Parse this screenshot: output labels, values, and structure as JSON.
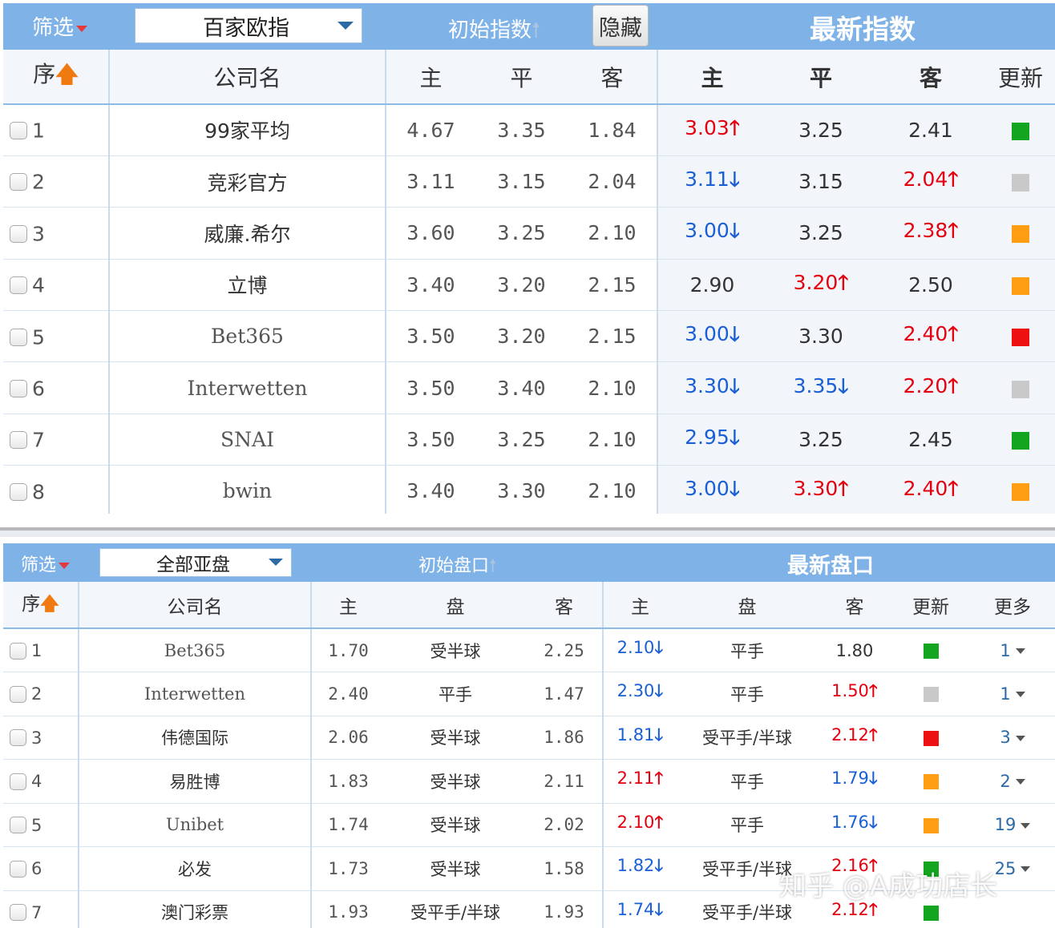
{
  "colors": {
    "header_bg": "#7fb3e8",
    "up": "#e4000f",
    "down": "#1a5fd6",
    "green": "#13a51f",
    "gray": "#c9c9c9",
    "orange": "#ff9d13",
    "red": "#ee1111"
  },
  "euro": {
    "filter_label": "筛选",
    "select_value": "百家欧指",
    "initial_label": "初始指数",
    "hide_button": "隐藏",
    "latest_label": "最新指数",
    "headers": {
      "seq": "序",
      "company": "公司名",
      "home": "主",
      "draw": "平",
      "away": "客",
      "home2": "主",
      "draw2": "平",
      "away2": "客",
      "update": "更新"
    },
    "rows": [
      {
        "idx": "1",
        "company": "99家平均",
        "font": "cjk",
        "ih": "4.67",
        "id": "3.35",
        "ia": "1.84",
        "lh": "3.03",
        "lh_dir": "up",
        "ld": "3.25",
        "ld_dir": "flat",
        "la": "2.41",
        "la_dir": "flat",
        "update_color": "green"
      },
      {
        "idx": "2",
        "company": "竞彩官方",
        "font": "cjk",
        "ih": "3.11",
        "id": "3.15",
        "ia": "2.04",
        "lh": "3.11",
        "lh_dir": "down",
        "ld": "3.15",
        "ld_dir": "flat",
        "la": "2.04",
        "la_dir": "up",
        "update_color": "gray"
      },
      {
        "idx": "3",
        "company": "威廉.希尔",
        "font": "cjk",
        "ih": "3.60",
        "id": "3.25",
        "ia": "2.10",
        "lh": "3.00",
        "lh_dir": "down",
        "ld": "3.25",
        "ld_dir": "flat",
        "la": "2.38",
        "la_dir": "up",
        "update_color": "orange"
      },
      {
        "idx": "4",
        "company": "立博",
        "font": "cjk",
        "ih": "3.40",
        "id": "3.20",
        "ia": "2.15",
        "lh": "2.90",
        "lh_dir": "flat",
        "ld": "3.20",
        "ld_dir": "up",
        "la": "2.50",
        "la_dir": "flat",
        "update_color": "orange"
      },
      {
        "idx": "5",
        "company": "Bet365",
        "font": "serif",
        "ih": "3.50",
        "id": "3.20",
        "ia": "2.15",
        "lh": "3.00",
        "lh_dir": "down",
        "ld": "3.30",
        "ld_dir": "flat",
        "la": "2.40",
        "la_dir": "up",
        "update_color": "red"
      },
      {
        "idx": "6",
        "company": "Interwetten",
        "font": "serif",
        "ih": "3.50",
        "id": "3.40",
        "ia": "2.10",
        "lh": "3.30",
        "lh_dir": "down",
        "ld": "3.35",
        "ld_dir": "down",
        "la": "2.20",
        "la_dir": "up",
        "update_color": "gray"
      },
      {
        "idx": "7",
        "company": "SNAI",
        "font": "serif",
        "ih": "3.50",
        "id": "3.25",
        "ia": "2.10",
        "lh": "2.95",
        "lh_dir": "down",
        "ld": "3.25",
        "ld_dir": "flat",
        "la": "2.45",
        "la_dir": "flat",
        "update_color": "green"
      },
      {
        "idx": "8",
        "company": "bwin",
        "font": "serif",
        "ih": "3.40",
        "id": "3.30",
        "ia": "2.10",
        "lh": "3.00",
        "lh_dir": "down",
        "ld": "3.30",
        "ld_dir": "up",
        "la": "2.40",
        "la_dir": "up",
        "update_color": "orange"
      }
    ]
  },
  "asian": {
    "filter_label": "筛选",
    "select_value": "全部亚盘",
    "initial_label": "初始盘口",
    "latest_label": "最新盘口",
    "headers": {
      "seq": "序",
      "company": "公司名",
      "home": "主",
      "handicap": "盘",
      "away": "客",
      "home2": "主",
      "handicap2": "盘",
      "away2": "客",
      "update": "更新",
      "more": "更多"
    },
    "rows": [
      {
        "idx": "1",
        "company": "Bet365",
        "font": "serif",
        "ih": "1.70",
        "ip": "受半球",
        "ia": "2.25",
        "lh": "2.10",
        "lh_dir": "down",
        "lp": "平手",
        "la": "1.80",
        "la_dir": "flat",
        "update_color": "green",
        "more": "1"
      },
      {
        "idx": "2",
        "company": "Interwetten",
        "font": "serif",
        "ih": "2.40",
        "ip": "平手",
        "ia": "1.47",
        "lh": "2.30",
        "lh_dir": "down",
        "lp": "平手",
        "la": "1.50",
        "la_dir": "up",
        "update_color": "gray",
        "more": "1"
      },
      {
        "idx": "3",
        "company": "伟德国际",
        "font": "cjk",
        "ih": "2.06",
        "ip": "受半球",
        "ia": "1.86",
        "lh": "1.81",
        "lh_dir": "down",
        "lp": "受平手/半球",
        "la": "2.12",
        "la_dir": "up",
        "update_color": "red",
        "more": "3"
      },
      {
        "idx": "4",
        "company": "易胜博",
        "font": "cjk",
        "ih": "1.83",
        "ip": "受半球",
        "ia": "2.11",
        "lh": "2.11",
        "lh_dir": "up",
        "lp": "平手",
        "la": "1.79",
        "la_dir": "down",
        "update_color": "orange",
        "more": "2"
      },
      {
        "idx": "5",
        "company": "Unibet",
        "font": "serif",
        "ih": "1.74",
        "ip": "受半球",
        "ia": "2.02",
        "lh": "2.10",
        "lh_dir": "up",
        "lp": "平手",
        "la": "1.76",
        "la_dir": "down",
        "update_color": "orange",
        "more": "19"
      },
      {
        "idx": "6",
        "company": "必发",
        "font": "cjk",
        "ih": "1.73",
        "ip": "受半球",
        "ia": "1.58",
        "lh": "1.82",
        "lh_dir": "down",
        "lp": "受平手/半球",
        "la": "2.16",
        "la_dir": "up",
        "update_color": "green",
        "more": "25"
      },
      {
        "idx": "7",
        "company": "澳门彩票",
        "font": "cjk",
        "ih": "1.93",
        "ip": "受平手/半球",
        "ia": "1.93",
        "lh": "1.74",
        "lh_dir": "down",
        "lp": "受平手/半球",
        "la": "2.12",
        "la_dir": "up",
        "update_color": "green",
        "more": ""
      }
    ]
  },
  "watermark": "知乎 @A成功店长"
}
